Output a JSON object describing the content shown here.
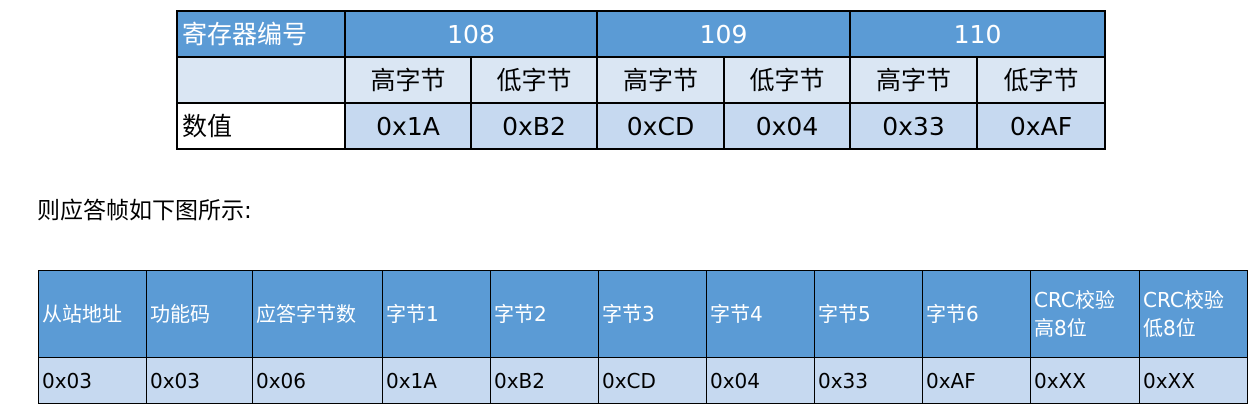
{
  "register_table": {
    "label_header": "寄存器编号",
    "registers": [
      "108",
      "109",
      "110"
    ],
    "byte_labels": [
      "高字节",
      "低字节",
      "高字节",
      "低字节",
      "高字节",
      "低字节"
    ],
    "value_label": "数值",
    "values": [
      "0x1A",
      "0xB2",
      "0xCD",
      "0x04",
      "0x33",
      "0xAF"
    ]
  },
  "paragraph": "则应答帧如下图所示:",
  "frame_table": {
    "headers": [
      "从站地址",
      "功能码",
      "应答字节数",
      "字节1",
      "字节2",
      "字节3",
      "字节4",
      "字节5",
      "字节6",
      "CRC校验\n高8位",
      "CRC校验\n低8位"
    ],
    "values": [
      "0x03",
      "0x03",
      "0x06",
      "0x1A",
      "0xB2",
      "0xCD",
      "0x04",
      "0x33",
      "0xAF",
      "0xXX",
      "0xXX"
    ]
  },
  "colors": {
    "header_blue": "#5b9bd5",
    "cell_light_blue": "#c6d9f0"
  }
}
